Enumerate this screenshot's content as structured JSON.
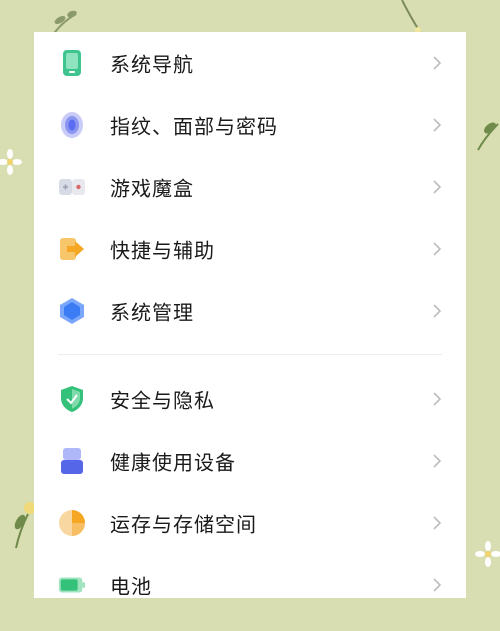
{
  "settings": {
    "items": [
      {
        "label": "系统导航",
        "icon": "phone-nav-icon",
        "color": "#3fc48f"
      },
      {
        "label": "指纹、面部与密码",
        "icon": "fingerprint-icon",
        "color": "#5b6cf0"
      },
      {
        "label": "游戏魔盒",
        "icon": "gamepad-icon",
        "color": "#d96a6a"
      },
      {
        "label": "快捷与辅助",
        "icon": "shortcut-arrow-icon",
        "color": "#f5a623"
      },
      {
        "label": "系统管理",
        "icon": "hexagon-gear-icon",
        "color": "#3b7cf5"
      },
      {
        "label": "安全与隐私",
        "icon": "shield-check-icon",
        "color": "#34c17a"
      },
      {
        "label": "健康使用设备",
        "icon": "hourglass-icon",
        "color": "#5567e8"
      },
      {
        "label": "运存与存储空间",
        "icon": "storage-pie-icon",
        "color": "#f5a623"
      },
      {
        "label": "电池",
        "icon": "battery-icon",
        "color": "#34c17a"
      }
    ]
  }
}
